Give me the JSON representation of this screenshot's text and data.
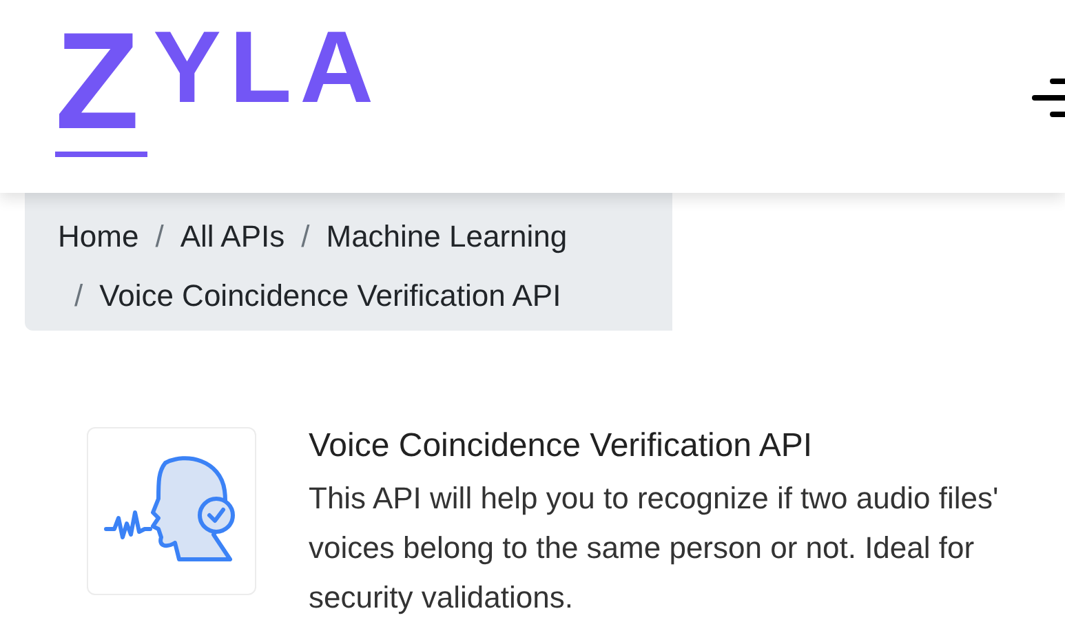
{
  "header": {
    "logo_initial": "Z",
    "logo_rest": "YLA"
  },
  "breadcrumb": [
    {
      "label": "Home"
    },
    {
      "label": "All APIs"
    },
    {
      "label": "Machine Learning"
    },
    {
      "label": "Voice Coincidence Verification API"
    }
  ],
  "separator": "/",
  "api": {
    "title": "Voice Coincidence Verification API",
    "description": "This API will help you to recognize if two audio files' voices belong to the same person or not. Ideal for security validations."
  }
}
